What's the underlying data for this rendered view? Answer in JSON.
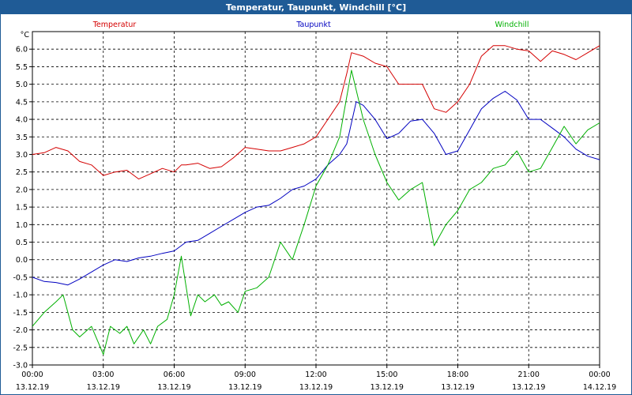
{
  "window": {
    "title": "Temperatur, Taupunkt, Windchill [°C]"
  },
  "chart_data": {
    "type": "line",
    "title": "Temperatur, Taupunkt, Windchill [°C]",
    "y_unit": "°C",
    "ylim": [
      -3.0,
      6.5
    ],
    "y_ticks": [
      "6.0",
      "5.5",
      "5.0",
      "4.5",
      "4.0",
      "3.5",
      "3.0",
      "2.5",
      "2.0",
      "1.5",
      "1.0",
      "0.5",
      "0.0",
      "-0.5",
      "-1.0",
      "-1.5",
      "-2.0",
      "-2.5",
      "-3.0"
    ],
    "x_ticks": [
      {
        "time": "00:00",
        "date": "13.12.19"
      },
      {
        "time": "03:00",
        "date": "13.12.19"
      },
      {
        "time": "06:00",
        "date": "13.12.19"
      },
      {
        "time": "09:00",
        "date": "13.12.19"
      },
      {
        "time": "12:00",
        "date": "13.12.19"
      },
      {
        "time": "15:00",
        "date": "13.12.19"
      },
      {
        "time": "18:00",
        "date": "13.12.19"
      },
      {
        "time": "21:00",
        "date": "13.12.19"
      },
      {
        "time": "00:00",
        "date": "14.12.19"
      }
    ],
    "x_hours_range": [
      0,
      24
    ],
    "grid": true,
    "legend_placement": "top",
    "series": [
      {
        "name": "Temperatur",
        "color": "#d40000",
        "x": [
          0,
          0.5,
          1,
          1.5,
          2,
          2.5,
          3,
          3.5,
          4,
          4.5,
          5,
          5.5,
          6,
          6.3,
          6.5,
          7,
          7.5,
          8,
          8.5,
          9,
          9.5,
          10,
          10.5,
          11,
          11.5,
          12,
          12.5,
          13,
          13.3,
          13.5,
          14,
          14.5,
          15,
          15.5,
          16,
          16.5,
          17,
          17.5,
          18,
          18.5,
          19,
          19.5,
          20,
          20.5,
          21,
          21.5,
          22,
          22.5,
          23,
          23.5,
          24
        ],
        "values": [
          3.0,
          3.05,
          3.2,
          3.1,
          2.8,
          2.7,
          2.4,
          2.5,
          2.55,
          2.3,
          2.45,
          2.6,
          2.5,
          2.7,
          2.7,
          2.75,
          2.6,
          2.65,
          2.9,
          3.2,
          3.15,
          3.1,
          3.1,
          3.2,
          3.3,
          3.5,
          4.0,
          4.5,
          5.3,
          5.9,
          5.8,
          5.6,
          5.5,
          5.0,
          5.0,
          5.0,
          4.3,
          4.2,
          4.5,
          5.0,
          5.8,
          6.1,
          6.1,
          6.0,
          5.95,
          5.65,
          5.95,
          5.85,
          5.7,
          5.9,
          6.1
        ]
      },
      {
        "name": "Taupunkt",
        "color": "#0000c0",
        "x": [
          0,
          0.5,
          1,
          1.5,
          2,
          2.5,
          3,
          3.5,
          4,
          4.5,
          5,
          5.5,
          6,
          6.5,
          7,
          7.5,
          8,
          8.5,
          9,
          9.5,
          10,
          10.5,
          11,
          11.5,
          12,
          12.5,
          13,
          13.3,
          13.7,
          14,
          14.5,
          15,
          15.5,
          16,
          16.5,
          17,
          17.5,
          18,
          18.5,
          19,
          19.5,
          20,
          20.5,
          21,
          21.5,
          22,
          22.5,
          23,
          23.5,
          24
        ],
        "values": [
          -0.5,
          -0.62,
          -0.65,
          -0.72,
          -0.55,
          -0.35,
          -0.15,
          0.0,
          -0.05,
          0.05,
          0.1,
          0.18,
          0.25,
          0.5,
          0.55,
          0.75,
          0.95,
          1.15,
          1.35,
          1.5,
          1.55,
          1.75,
          2.0,
          2.1,
          2.3,
          2.7,
          3.0,
          3.3,
          4.5,
          4.4,
          4.0,
          3.45,
          3.6,
          3.95,
          4.0,
          3.6,
          3.0,
          3.1,
          3.7,
          4.3,
          4.6,
          4.8,
          4.55,
          4.0,
          4.0,
          3.75,
          3.5,
          3.15,
          2.95,
          2.85
        ]
      },
      {
        "name": "Windchill",
        "color": "#00b000",
        "x": [
          0,
          0.5,
          1,
          1.3,
          1.7,
          2,
          2.5,
          3,
          3.3,
          3.7,
          4,
          4.3,
          4.7,
          5,
          5.3,
          5.7,
          6,
          6.3,
          6.7,
          7,
          7.3,
          7.7,
          8,
          8.3,
          8.7,
          9,
          9.5,
          10,
          10.5,
          11,
          11.5,
          12,
          12.5,
          13,
          13.5,
          14,
          14.5,
          15,
          15.5,
          16,
          16.5,
          17,
          17.5,
          18,
          18.5,
          19,
          19.5,
          20,
          20.5,
          21,
          21.5,
          22,
          22.5,
          23,
          23.5,
          24
        ],
        "values": [
          -1.9,
          -1.5,
          -1.2,
          -1.0,
          -2.0,
          -2.2,
          -1.9,
          -2.7,
          -1.9,
          -2.1,
          -1.9,
          -2.4,
          -2.0,
          -2.4,
          -1.9,
          -1.7,
          -1.0,
          0.1,
          -1.6,
          -1.0,
          -1.2,
          -1.0,
          -1.3,
          -1.2,
          -1.5,
          -0.9,
          -0.8,
          -0.5,
          0.5,
          0.0,
          1.0,
          2.1,
          2.7,
          3.5,
          5.4,
          4.0,
          3.0,
          2.2,
          1.7,
          2.0,
          2.2,
          0.4,
          1.0,
          1.4,
          2.0,
          2.2,
          2.6,
          2.7,
          3.1,
          2.5,
          2.6,
          3.2,
          3.8,
          3.3,
          3.7,
          3.9
        ]
      }
    ]
  }
}
